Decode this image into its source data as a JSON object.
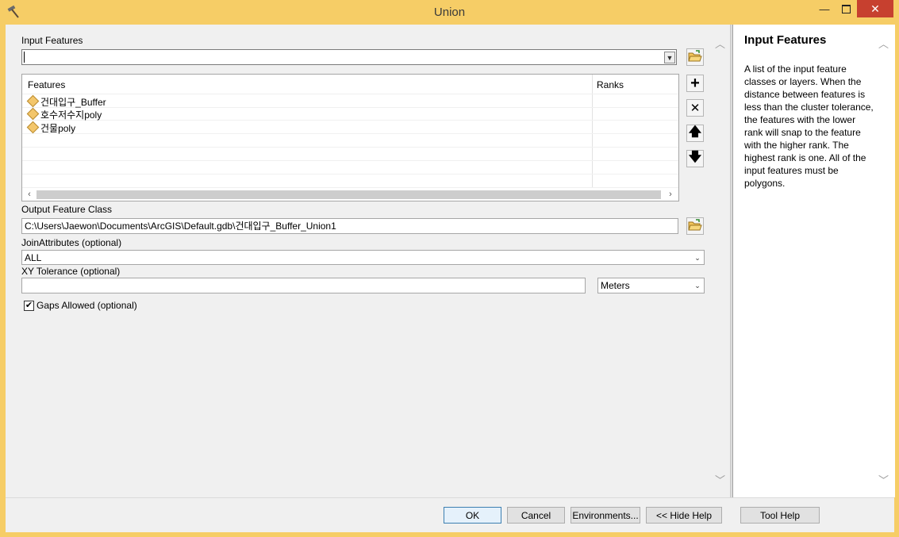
{
  "window": {
    "title": "Union"
  },
  "input_features": {
    "label": "Input Features",
    "value": "",
    "list_headers": {
      "features": "Features",
      "ranks": "Ranks"
    },
    "items": [
      {
        "name": "건대입구_Buffer",
        "rank": ""
      },
      {
        "name": "호수저수지poly",
        "rank": ""
      },
      {
        "name": "건물poly",
        "rank": ""
      }
    ]
  },
  "output_feature_class": {
    "label": "Output Feature Class",
    "value": "C:\\Users\\Jaewon\\Documents\\ArcGIS\\Default.gdb\\건대입구_Buffer_Union1"
  },
  "join_attributes": {
    "label": "JoinAttributes (optional)",
    "value": "ALL"
  },
  "xy_tolerance": {
    "label": "XY Tolerance (optional)",
    "value": "",
    "unit": "Meters"
  },
  "gaps_allowed": {
    "label": "Gaps Allowed (optional)",
    "checked": true
  },
  "help": {
    "title": "Input Features",
    "text": "A list of the input feature classes or layers. When the distance between features is less than the cluster tolerance, the features with the lower rank will snap to the feature with the higher rank. The highest rank is one. All of the input features must be polygons."
  },
  "buttons": {
    "ok": "OK",
    "cancel": "Cancel",
    "environments": "Environments...",
    "hide_help": "<< Hide Help",
    "tool_help": "Tool Help"
  }
}
